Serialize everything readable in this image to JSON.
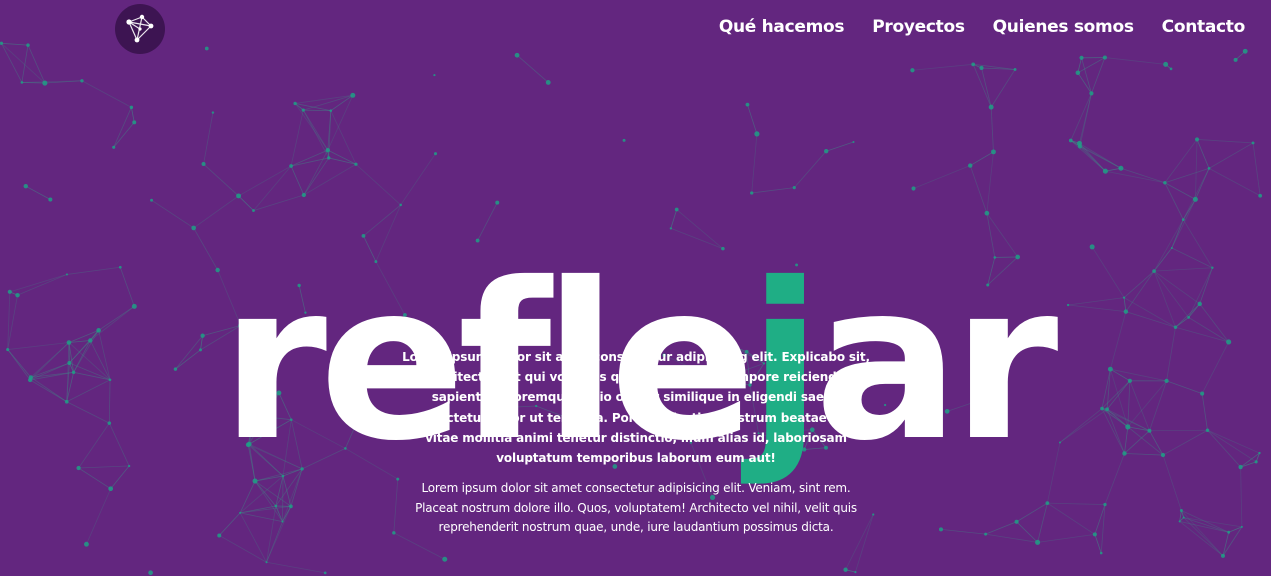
{
  "nav": {
    "items": [
      {
        "label": "Qué hacemos"
      },
      {
        "label": "Proyectos"
      },
      {
        "label": "Quienes somos"
      },
      {
        "label": "Contacto"
      }
    ]
  },
  "hero": {
    "title_before": "refle",
    "title_accent": "j",
    "title_after": "ar"
  },
  "intro": {
    "lead": "Lorem ipsum, dolor sit amet consectetur adipisicing elit. Explicabo sit, architecto sint qui voluptas quidem dolorem tempore reiciendis sapiente doloremque. Odio odit et similique in eligendi saepe consectetur dolor ut tempora. Porro molestiae nostrum beatae unde vitae mollitia animi tenetur distinctio, illum alias id, laboriosam voluptatum temporibus laborum eum aut!",
    "body": "Lorem ipsum dolor sit amet consectetur adipisicing elit. Veniam, sint rem. Placeat nostrum dolore illo. Quos, voluptatem! Architecto vel nihil, velit quis reprehenderit nostrum quae, unde, iure laudantium possimus dicta."
  },
  "colors": {
    "background": "#63267f",
    "accent": "#1fae85",
    "text": "#ffffff",
    "network_line": "#3f8a86",
    "network_node": "#1e9f86",
    "logo_bg": "#3d1452"
  },
  "icons": {
    "logo": "network-logo-icon",
    "background": "particle-network"
  }
}
